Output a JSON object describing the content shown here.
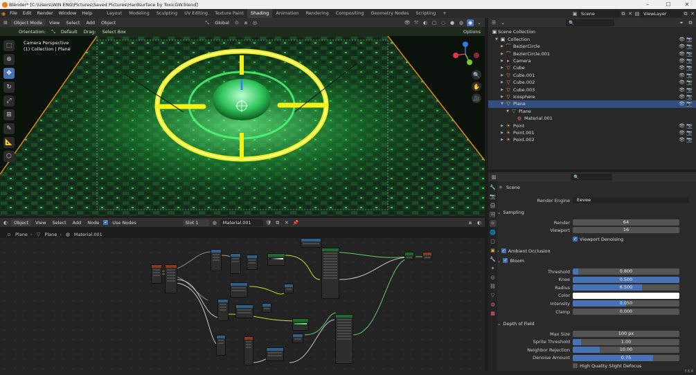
{
  "window": {
    "title": "Blender* [C:\\Users\\WIN ENG\\Pictures\\Saved Pictures\\Hardsurface by ToxicGW.blend]",
    "minimize": "–",
    "maximize": "☐",
    "close": "✕"
  },
  "menu": [
    "File",
    "Edit",
    "Render",
    "Window",
    "Help"
  ],
  "workspaces": [
    "Layout",
    "Modeling",
    "Sculpting",
    "UV Editing",
    "Texture Paint",
    "Shading",
    "Animation",
    "Rendering",
    "Compositing",
    "Geometry Nodes",
    "Scripting",
    "+"
  ],
  "active_workspace": "Shading",
  "scene_selector": {
    "label": "Scene"
  },
  "viewlayer_selector": {
    "label": "ViewLayer"
  },
  "viewport_header": {
    "mode": "Object Mode",
    "view": "View",
    "select": "Select",
    "add": "Add",
    "object": "Object",
    "orientation": "Global"
  },
  "viewport_subheader": {
    "orientation_label": "Orientation:",
    "orientation_value": "Default",
    "drag_label": "Drag:",
    "drag_value": "Select Box",
    "options": "Options"
  },
  "viewport_overlay": {
    "line1": "Camera Perspective",
    "line2": "(1) Collection | Plane"
  },
  "node_editor_header": {
    "editor": "Object",
    "view": "View",
    "select": "Select",
    "add": "Add",
    "node": "Node",
    "use_nodes": "Use Nodes",
    "slot": "Slot 1",
    "material": "Material.001"
  },
  "breadcrumb": {
    "obj": "Plane",
    "mesh": "Plane",
    "material": "Material.001"
  },
  "outliner": {
    "root": "Scene Collection",
    "items": [
      {
        "label": "Collection",
        "level": 1,
        "icon": "collection-icon"
      },
      {
        "label": "BezierCircle",
        "level": 2,
        "icon": "curve-icon"
      },
      {
        "label": "BezierCircle.001",
        "level": 2,
        "icon": "curve-icon"
      },
      {
        "label": "Camera",
        "level": 2,
        "icon": "camera-icon"
      },
      {
        "label": "Cube",
        "level": 2,
        "icon": "mesh-icon"
      },
      {
        "label": "Cube.001",
        "level": 2,
        "icon": "mesh-icon"
      },
      {
        "label": "Cube.002",
        "level": 2,
        "icon": "mesh-icon"
      },
      {
        "label": "Cube.003",
        "level": 2,
        "icon": "mesh-icon"
      },
      {
        "label": "Icosphere",
        "level": 2,
        "icon": "mesh-icon"
      },
      {
        "label": "Plane",
        "level": 2,
        "icon": "mesh-icon",
        "selected": true
      },
      {
        "label": "Plane",
        "level": 3,
        "icon": "mesh-data-icon"
      },
      {
        "label": "Material.001",
        "level": 4,
        "icon": "material-icon"
      },
      {
        "label": "Point",
        "level": 2,
        "icon": "light-icon"
      },
      {
        "label": "Point.001",
        "level": 2,
        "icon": "light-icon"
      },
      {
        "label": "Point.002",
        "level": 2,
        "icon": "light-icon"
      }
    ]
  },
  "properties": {
    "context": "Scene",
    "render_engine_label": "Render Engine",
    "render_engine": "Eevee",
    "sampling": {
      "title": "Sampling",
      "render_label": "Render",
      "render": "64",
      "viewport_label": "Viewport",
      "viewport": "16",
      "denoise": "Viewport Denoising"
    },
    "ao": {
      "title": "Ambient Occlusion",
      "enabled": true
    },
    "bloom": {
      "title": "Bloom",
      "enabled": true,
      "fields": [
        {
          "label": "Threshold",
          "value": "0.800",
          "fill": 0.05
        },
        {
          "label": "Knee",
          "value": "0.500",
          "fill": 1.0
        },
        {
          "label": "Radius",
          "value": "6.500",
          "fill": 0.65
        },
        {
          "label": "Color",
          "value": "",
          "fill": 0,
          "color": "#ffffff"
        },
        {
          "label": "Intensity",
          "value": "0.050",
          "fill": 0.5
        },
        {
          "label": "Clamp",
          "value": "0.000",
          "fill": 0
        }
      ]
    },
    "dof": {
      "title": "Depth of Field",
      "fields": [
        {
          "label": "Max Size",
          "value": "100 px",
          "fill": 0
        },
        {
          "label": "Sprite Threshold",
          "value": "1.00",
          "fill": 0.08
        },
        {
          "label": "Neighbor Rejection",
          "value": "10.00",
          "fill": 0.25
        },
        {
          "label": "Denoise Amount",
          "value": "0.75",
          "fill": 0.75
        }
      ],
      "hq": "High Quality Slight Defocus"
    }
  },
  "status": {
    "version": "3.6.4"
  },
  "colors": {
    "accent": "#4772b3",
    "selected_row": "#334d80",
    "neon_yellow": "#f2f21a",
    "neon_green": "#2bff5a"
  }
}
